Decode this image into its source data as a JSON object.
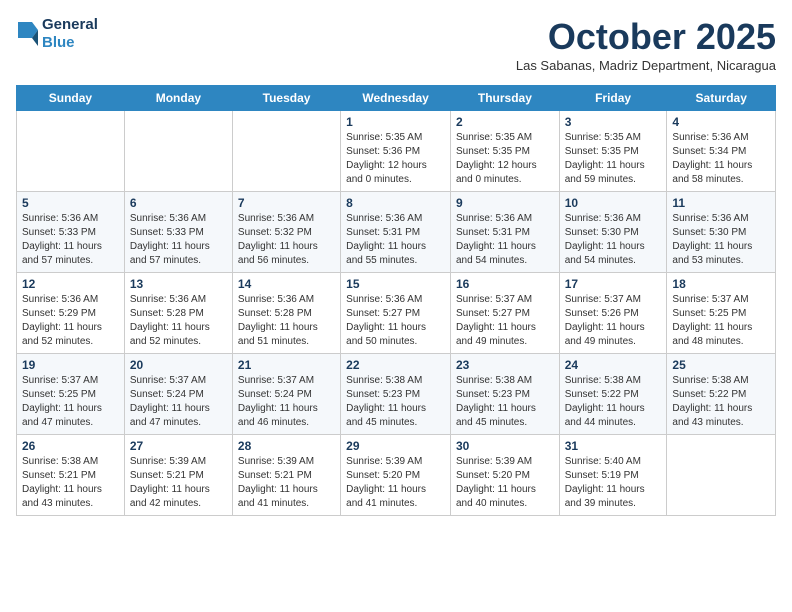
{
  "logo": {
    "line1": "General",
    "line2": "Blue"
  },
  "title": "October 2025",
  "subtitle": "Las Sabanas, Madriz Department, Nicaragua",
  "weekdays": [
    "Sunday",
    "Monday",
    "Tuesday",
    "Wednesday",
    "Thursday",
    "Friday",
    "Saturday"
  ],
  "weeks": [
    [
      {
        "day": "",
        "info": ""
      },
      {
        "day": "",
        "info": ""
      },
      {
        "day": "",
        "info": ""
      },
      {
        "day": "1",
        "info": "Sunrise: 5:35 AM\nSunset: 5:36 PM\nDaylight: 12 hours\nand 0 minutes."
      },
      {
        "day": "2",
        "info": "Sunrise: 5:35 AM\nSunset: 5:35 PM\nDaylight: 12 hours\nand 0 minutes."
      },
      {
        "day": "3",
        "info": "Sunrise: 5:35 AM\nSunset: 5:35 PM\nDaylight: 11 hours\nand 59 minutes."
      },
      {
        "day": "4",
        "info": "Sunrise: 5:36 AM\nSunset: 5:34 PM\nDaylight: 11 hours\nand 58 minutes."
      }
    ],
    [
      {
        "day": "5",
        "info": "Sunrise: 5:36 AM\nSunset: 5:33 PM\nDaylight: 11 hours\nand 57 minutes."
      },
      {
        "day": "6",
        "info": "Sunrise: 5:36 AM\nSunset: 5:33 PM\nDaylight: 11 hours\nand 57 minutes."
      },
      {
        "day": "7",
        "info": "Sunrise: 5:36 AM\nSunset: 5:32 PM\nDaylight: 11 hours\nand 56 minutes."
      },
      {
        "day": "8",
        "info": "Sunrise: 5:36 AM\nSunset: 5:31 PM\nDaylight: 11 hours\nand 55 minutes."
      },
      {
        "day": "9",
        "info": "Sunrise: 5:36 AM\nSunset: 5:31 PM\nDaylight: 11 hours\nand 54 minutes."
      },
      {
        "day": "10",
        "info": "Sunrise: 5:36 AM\nSunset: 5:30 PM\nDaylight: 11 hours\nand 54 minutes."
      },
      {
        "day": "11",
        "info": "Sunrise: 5:36 AM\nSunset: 5:30 PM\nDaylight: 11 hours\nand 53 minutes."
      }
    ],
    [
      {
        "day": "12",
        "info": "Sunrise: 5:36 AM\nSunset: 5:29 PM\nDaylight: 11 hours\nand 52 minutes."
      },
      {
        "day": "13",
        "info": "Sunrise: 5:36 AM\nSunset: 5:28 PM\nDaylight: 11 hours\nand 52 minutes."
      },
      {
        "day": "14",
        "info": "Sunrise: 5:36 AM\nSunset: 5:28 PM\nDaylight: 11 hours\nand 51 minutes."
      },
      {
        "day": "15",
        "info": "Sunrise: 5:36 AM\nSunset: 5:27 PM\nDaylight: 11 hours\nand 50 minutes."
      },
      {
        "day": "16",
        "info": "Sunrise: 5:37 AM\nSunset: 5:27 PM\nDaylight: 11 hours\nand 49 minutes."
      },
      {
        "day": "17",
        "info": "Sunrise: 5:37 AM\nSunset: 5:26 PM\nDaylight: 11 hours\nand 49 minutes."
      },
      {
        "day": "18",
        "info": "Sunrise: 5:37 AM\nSunset: 5:25 PM\nDaylight: 11 hours\nand 48 minutes."
      }
    ],
    [
      {
        "day": "19",
        "info": "Sunrise: 5:37 AM\nSunset: 5:25 PM\nDaylight: 11 hours\nand 47 minutes."
      },
      {
        "day": "20",
        "info": "Sunrise: 5:37 AM\nSunset: 5:24 PM\nDaylight: 11 hours\nand 47 minutes."
      },
      {
        "day": "21",
        "info": "Sunrise: 5:37 AM\nSunset: 5:24 PM\nDaylight: 11 hours\nand 46 minutes."
      },
      {
        "day": "22",
        "info": "Sunrise: 5:38 AM\nSunset: 5:23 PM\nDaylight: 11 hours\nand 45 minutes."
      },
      {
        "day": "23",
        "info": "Sunrise: 5:38 AM\nSunset: 5:23 PM\nDaylight: 11 hours\nand 45 minutes."
      },
      {
        "day": "24",
        "info": "Sunrise: 5:38 AM\nSunset: 5:22 PM\nDaylight: 11 hours\nand 44 minutes."
      },
      {
        "day": "25",
        "info": "Sunrise: 5:38 AM\nSunset: 5:22 PM\nDaylight: 11 hours\nand 43 minutes."
      }
    ],
    [
      {
        "day": "26",
        "info": "Sunrise: 5:38 AM\nSunset: 5:21 PM\nDaylight: 11 hours\nand 43 minutes."
      },
      {
        "day": "27",
        "info": "Sunrise: 5:39 AM\nSunset: 5:21 PM\nDaylight: 11 hours\nand 42 minutes."
      },
      {
        "day": "28",
        "info": "Sunrise: 5:39 AM\nSunset: 5:21 PM\nDaylight: 11 hours\nand 41 minutes."
      },
      {
        "day": "29",
        "info": "Sunrise: 5:39 AM\nSunset: 5:20 PM\nDaylight: 11 hours\nand 41 minutes."
      },
      {
        "day": "30",
        "info": "Sunrise: 5:39 AM\nSunset: 5:20 PM\nDaylight: 11 hours\nand 40 minutes."
      },
      {
        "day": "31",
        "info": "Sunrise: 5:40 AM\nSunset: 5:19 PM\nDaylight: 11 hours\nand 39 minutes."
      },
      {
        "day": "",
        "info": ""
      }
    ]
  ]
}
